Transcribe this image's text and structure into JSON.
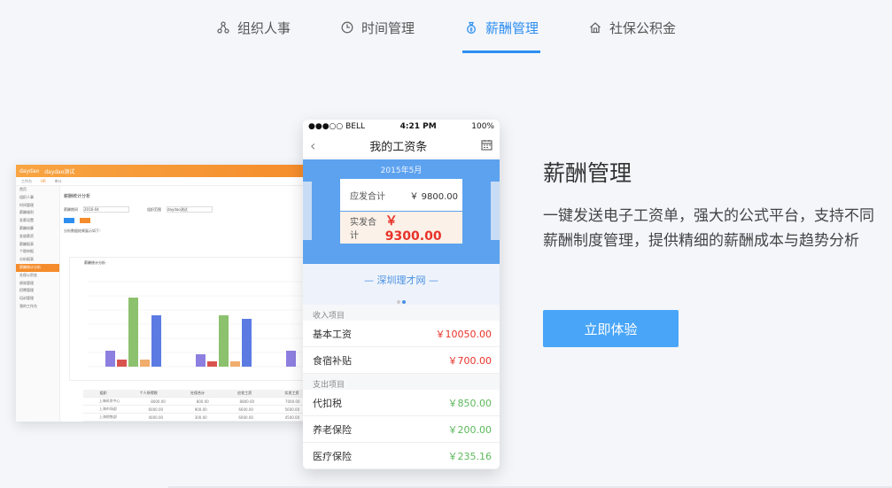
{
  "tabs": [
    {
      "label": "组织人事",
      "icon": "org-icon",
      "active": false
    },
    {
      "label": "时间管理",
      "icon": "clock-icon",
      "active": false
    },
    {
      "label": "薪酬管理",
      "icon": "money-bag-icon",
      "active": true
    },
    {
      "label": "社保公积金",
      "icon": "house-icon",
      "active": false
    }
  ],
  "accent": "#2d8ef0",
  "desktop": {
    "logo": "daydao",
    "company": "daydao测试",
    "nav_tabs": [
      "工作台",
      "HR",
      "审计"
    ],
    "side_items": [
      "首页",
      "组织人事",
      "时间管理",
      "薪酬福利",
      "发薪设置",
      "薪酬核算",
      "发放薪资",
      "薪酬报表",
      "个税申报",
      "分析报表",
      "薪酬统计分析",
      "社保公积金",
      "绩效管理",
      "招聘管理",
      "培训管理",
      "我的工作台"
    ],
    "page_title": "薪酬统计分析",
    "filter_period_label": "薪酬期间",
    "filter_period_value": "2016-04",
    "filter_scope_label": "组织范围",
    "filter_scope_value": "daydao测试",
    "summary": "分析数据结果展示如下：",
    "chart_title": "薪酬统计分析",
    "table_headers": [
      "组织",
      "个人所得税",
      "社保合计",
      "应发工资",
      "实发工资"
    ],
    "table_rows": [
      [
        "上海研发中心",
        "8000.00",
        "800.00",
        "8800.00",
        "7000.00"
      ],
      [
        "上海市场部",
        "6000.00",
        "900.00",
        "6600.00",
        "5600.00"
      ],
      [
        "上海销售部",
        "4000.00",
        "300.00",
        "6000.00",
        "4500.00"
      ]
    ]
  },
  "phone": {
    "carrier": "●●●○○ BELL",
    "time": "4:21 PM",
    "battery": "100%",
    "title": "我的工资条",
    "month": "2015年5月",
    "gross_label": "应发合计",
    "gross_value": "￥ 9800.00",
    "net_label": "实发合计",
    "net_value": "￥ 9300.00",
    "banner": "— 深圳理才网 —",
    "income_section": "收入项目",
    "income": [
      {
        "label": "基本工资",
        "value": "￥10050.00"
      },
      {
        "label": "食宿补贴",
        "value": "￥700.00"
      }
    ],
    "expense_section": "支出项目",
    "expense": [
      {
        "label": "代扣税",
        "value": "￥850.00"
      },
      {
        "label": "养老保险",
        "value": "￥200.00"
      },
      {
        "label": "医疗保险",
        "value": "￥235.16"
      }
    ]
  },
  "feature": {
    "title": "薪酬管理",
    "description": "一键发送电子工资单，强大的公式平台，支持不同薪酬制度管理，提供精细的薪酬成本与趋势分析",
    "cta": "立即体验"
  }
}
